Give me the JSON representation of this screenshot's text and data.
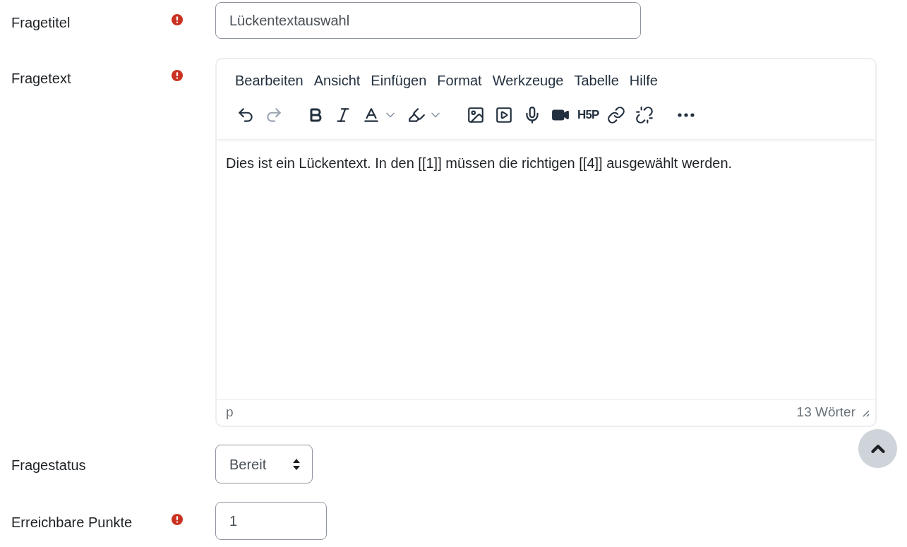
{
  "fields": [
    {
      "kind": "text",
      "label": "Fragetitel",
      "required": true,
      "value": "Lückentextauswahl"
    },
    {
      "kind": "editor",
      "label": "Fragetext",
      "required": true,
      "menu": [
        "Bearbeiten",
        "Ansicht",
        "Einfügen",
        "Format",
        "Werkzeuge",
        "Tabelle",
        "Hilfe"
      ],
      "toolbar": [
        {
          "kind": "undo",
          "disabled": false
        },
        {
          "kind": "redo",
          "disabled": true
        },
        {
          "kind": "gap"
        },
        {
          "kind": "bold",
          "disabled": false
        },
        {
          "kind": "italic",
          "disabled": false
        },
        {
          "kind": "text-color",
          "disabled": false
        },
        {
          "kind": "highlight",
          "disabled": false
        },
        {
          "kind": "gap"
        },
        {
          "kind": "image",
          "disabled": false
        },
        {
          "kind": "media",
          "disabled": false
        },
        {
          "kind": "audio",
          "disabled": false
        },
        {
          "kind": "video",
          "disabled": false
        },
        {
          "kind": "h5p",
          "label": "H5P",
          "disabled": false
        },
        {
          "kind": "link",
          "disabled": false
        },
        {
          "kind": "unlink",
          "disabled": false
        },
        {
          "kind": "gap"
        },
        {
          "kind": "more",
          "disabled": false
        }
      ],
      "content": "Dies ist ein Lückentext. In den [[1]] müssen die richtigen [[4]] ausgewählt werden.",
      "path": "p",
      "word_count": "13 Wörter"
    },
    {
      "kind": "select",
      "label": "Fragestatus",
      "required": false,
      "value": "Bereit"
    },
    {
      "kind": "number",
      "label": "Erreichbare Punkte",
      "required": true,
      "value": "1"
    }
  ]
}
